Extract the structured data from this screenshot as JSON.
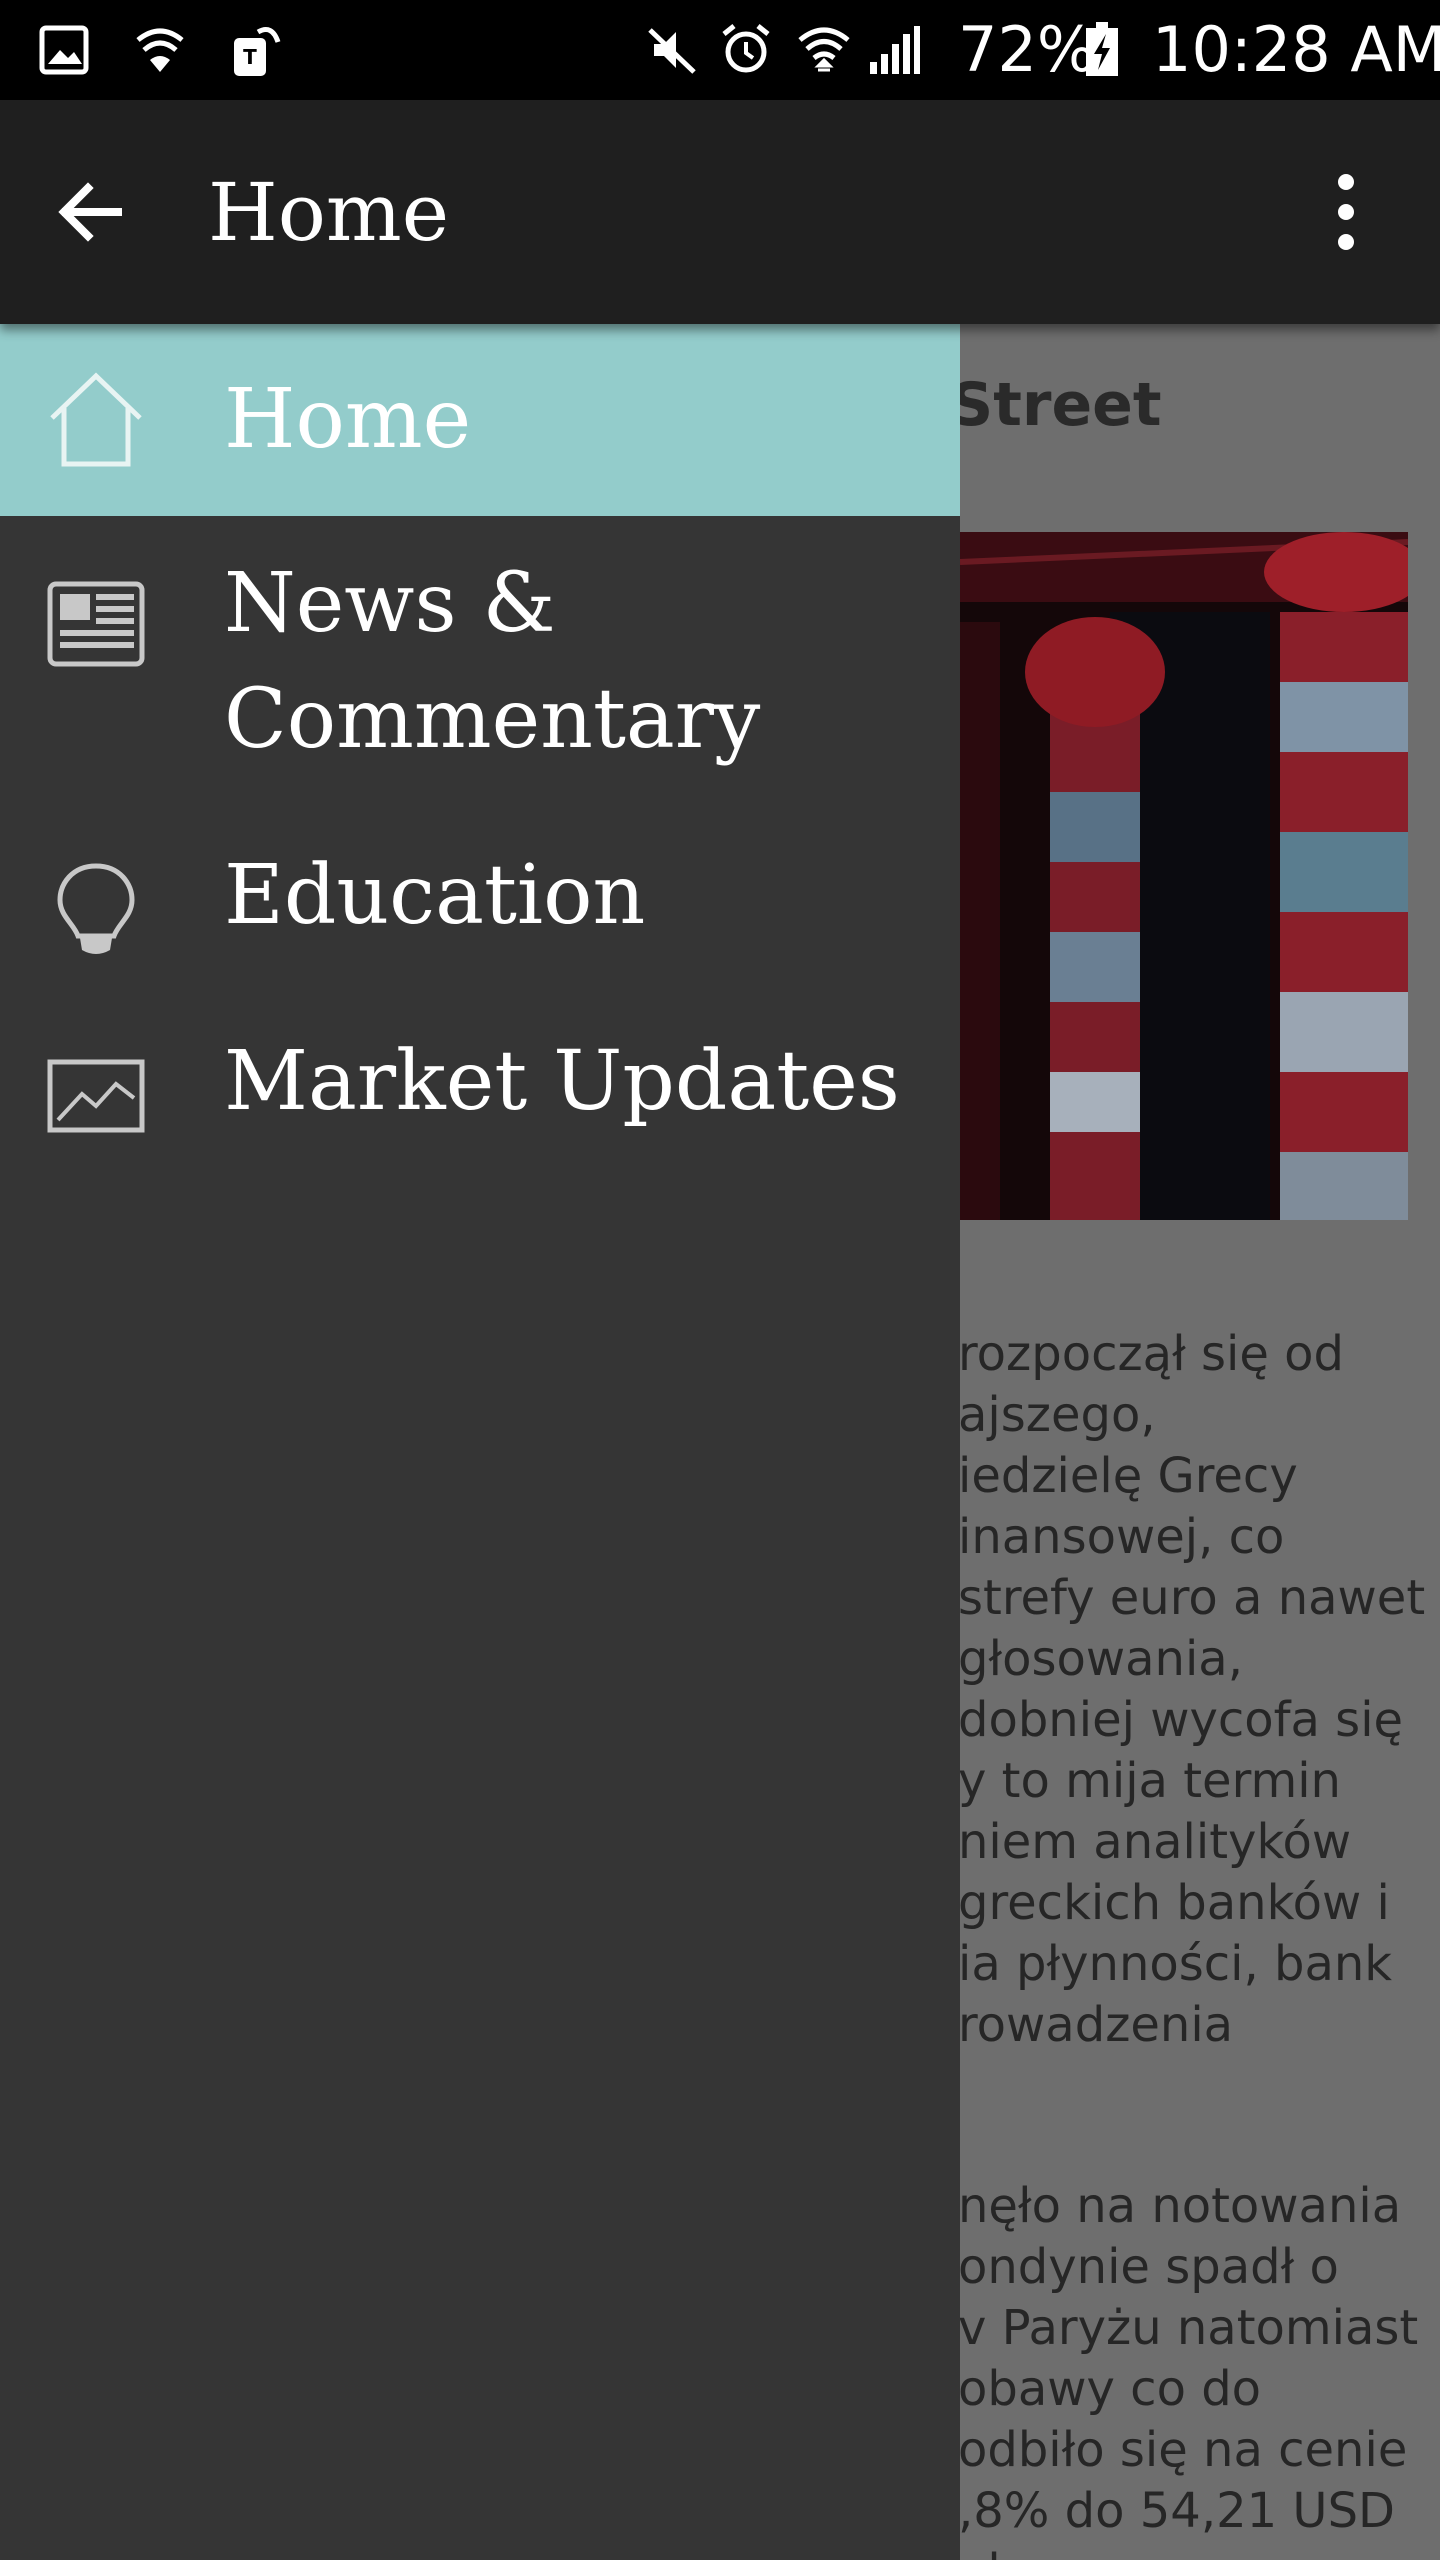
{
  "status_bar": {
    "battery": "72%",
    "time": "10:28 AM",
    "icons": [
      "gallery-icon",
      "wifi-shield-icon",
      "tmobile-icon",
      "mute-icon",
      "alarm-icon",
      "wifi-icon",
      "signal-icon",
      "battery-charging-icon"
    ]
  },
  "app_bar": {
    "title": "Home",
    "back_icon": "arrow-back-icon",
    "overflow_icon": "more-vert-icon"
  },
  "drawer": {
    "items": [
      {
        "label": "Home",
        "icon": "home-icon",
        "active": true
      },
      {
        "label": "News & Commentary",
        "icon": "newspaper-icon",
        "active": false
      },
      {
        "label": "Education",
        "icon": "lightbulb-icon",
        "active": false
      },
      {
        "label": "Market Updates",
        "icon": "chart-icon",
        "active": false
      }
    ],
    "active_color": "#93cccb",
    "background": "#353535"
  },
  "article": {
    "headline": "Street",
    "paragraph1": [
      "rozpoczął się od",
      "ajszego,",
      "iedzielę Grecy",
      "inansowej, co",
      "strefy euro a nawet",
      " głosowania,",
      "dobniej wycofa się",
      "y to mija termin",
      "niem analityków",
      " greckich banków i",
      "ia płynności, bank",
      "rowadzenia"
    ],
    "paragraph2": [
      "nęło na notowania",
      "ondynie spadł o",
      "v Paryżu natomiast",
      " obawy co do",
      "odbiło się na cenie",
      ",8% do 54,21 USD",
      "ol"
    ]
  }
}
